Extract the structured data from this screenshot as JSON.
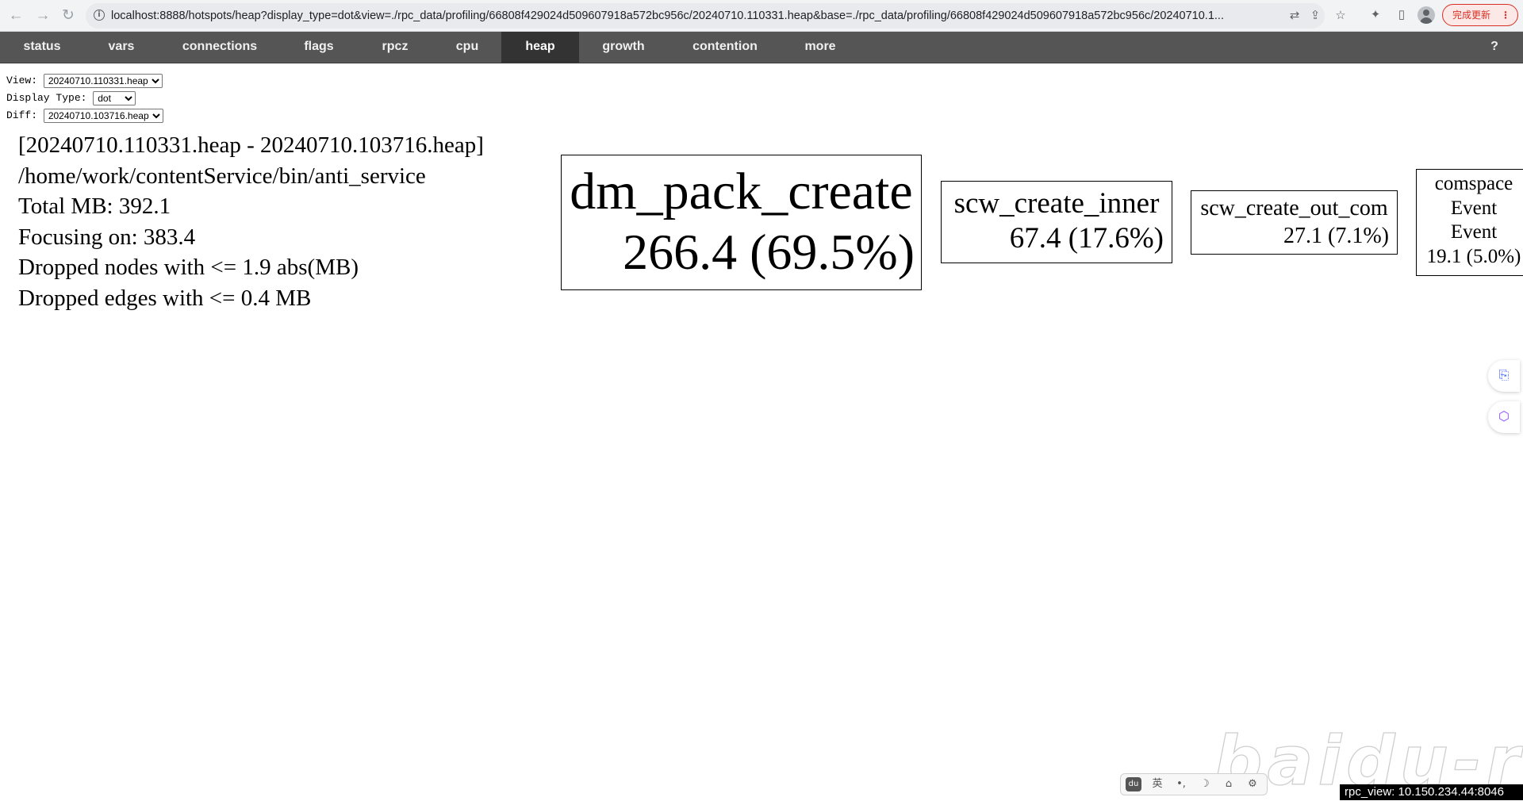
{
  "browser": {
    "url": "localhost:8888/hotspots/heap?display_type=dot&view=./rpc_data/profiling/66808f429024d509607918a572bc956c/20240710.110331.heap&base=./rpc_data/profiling/66808f429024d509607918a572bc956c/20240710.1...",
    "update_label": "完成更新",
    "icons": [
      "back-icon",
      "forward-icon",
      "reload-icon",
      "info-icon",
      "translate-icon",
      "share-icon",
      "star-icon",
      "extensions-icon",
      "sidepanel-icon",
      "profile-avatar",
      "menu-icon"
    ]
  },
  "tabs": [
    {
      "label": "status"
    },
    {
      "label": "vars"
    },
    {
      "label": "connections"
    },
    {
      "label": "flags"
    },
    {
      "label": "rpcz"
    },
    {
      "label": "cpu"
    },
    {
      "label": "heap",
      "active": true
    },
    {
      "label": "growth"
    },
    {
      "label": "contention"
    },
    {
      "label": "more"
    }
  ],
  "help_label": "?",
  "controls": {
    "view_label": "View:",
    "view_value": "20240710.110331.heap",
    "display_type_label": "Display Type:",
    "display_type_value": "dot",
    "diff_label": "Diff:",
    "diff_value": "20240710.103716.heap"
  },
  "summary": {
    "line1": "[20240710.110331.heap - 20240710.103716.heap]",
    "line2": "/home/work/contentService/bin/anti_service",
    "line3": "Total MB: 392.1",
    "line4": "Focusing on: 383.4",
    "line5": "Dropped nodes with <= 1.9 abs(MB)",
    "line6": "Dropped edges with <= 0.4 MB"
  },
  "nodes": [
    {
      "name": "dm_pack_create",
      "value": "266.4 (69.5%)"
    },
    {
      "name": "scw_create_inner",
      "value": "67.4 (17.6%)"
    },
    {
      "name": "scw_create_out_com",
      "value": "27.1 (7.1%)"
    },
    {
      "name_lines": [
        "comspace",
        "Event",
        "Event"
      ],
      "value": "19.1 (5.0%)"
    }
  ],
  "ime": {
    "items": [
      "du",
      "英",
      "•,",
      "☽",
      "⌂",
      "⚙"
    ]
  },
  "watermark": "baidu-rpc",
  "footer": "rpc_view: 10.150.234.44:8046",
  "colors": {
    "tabbar_bg": "#555555",
    "tab_active_bg": "#333333",
    "footer_bg": "#000000",
    "update_accent": "#d93025"
  }
}
